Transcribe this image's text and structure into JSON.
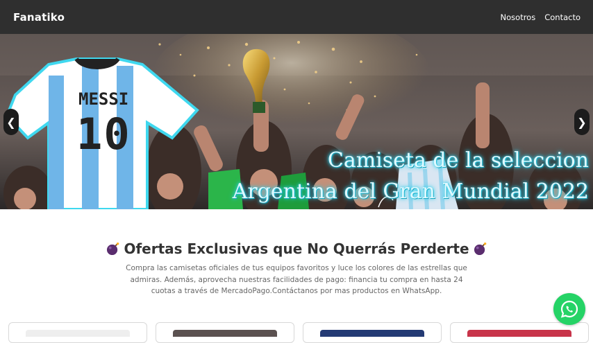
{
  "navbar": {
    "brand": "Fanatiko",
    "links": [
      "Nosotros",
      "Contacto"
    ]
  },
  "hero": {
    "title_line1": "Camiseta de la seleccion",
    "title_line2": "Argentina del Gran Mundial 2022",
    "jersey_name": "MESSI",
    "jersey_number": "10",
    "prev_label": "❮",
    "next_label": "❯"
  },
  "offers": {
    "title": "Ofertas Exclusivas que No Querrás Perderte",
    "description": "Compra las camisetas oficiales de tus equipos favoritos y luce los colores de las estrellas que admiras. Además, aprovecha nuestras facilidades de pago: financia tu compra en hasta 24 cuotas a través de MercadoPago.Contáctanos por mas productos en WhatsApp."
  },
  "colors": {
    "navbar": "#2f2f2f",
    "whatsapp": "#25d366",
    "hero_title_glow": "#2fd6f0"
  },
  "icons": [
    "bomb-icon",
    "whatsapp-icon",
    "chevron-left-icon",
    "chevron-right-icon"
  ]
}
